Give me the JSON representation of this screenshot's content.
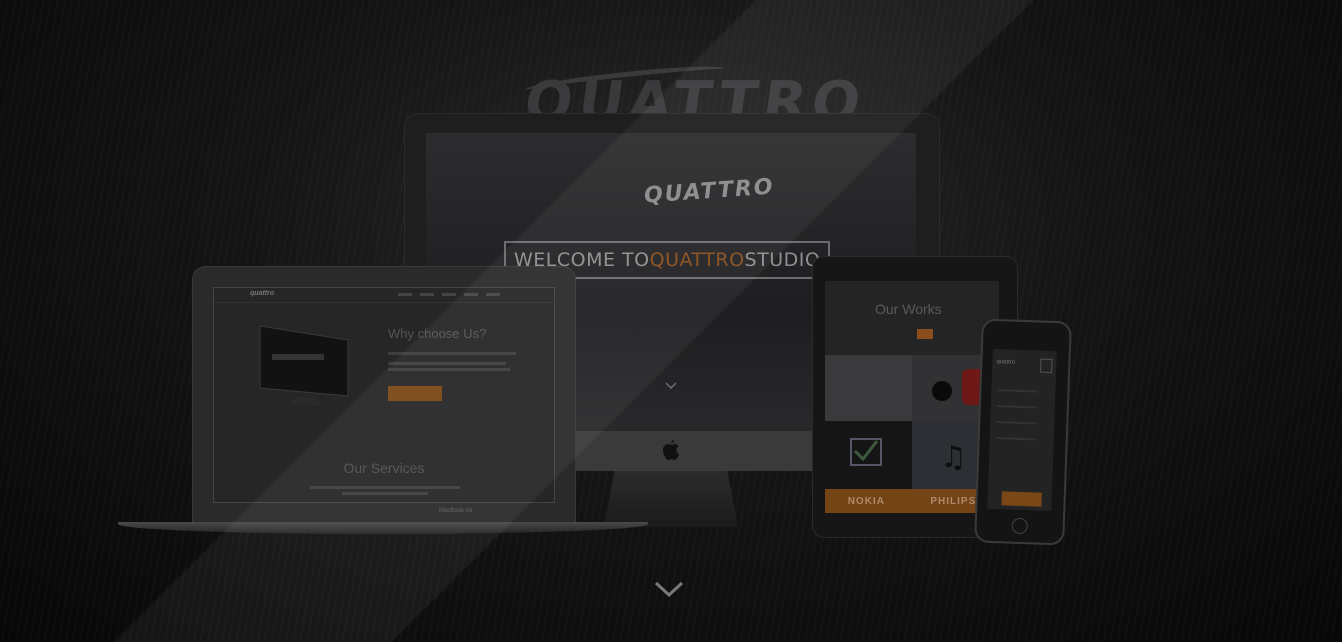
{
  "hero": {
    "background_logo": "QUATTRO",
    "accent_color": "#c96a1e"
  },
  "imac": {
    "screen_logo": "QUATTRO",
    "welcome_prefix": "WELCOME TO ",
    "welcome_accent": "QUATTRO",
    "welcome_suffix": " STUDIO"
  },
  "laptop": {
    "heading": "Why choose Us?",
    "section_title": "Our Services",
    "model_label": "MacBook Air",
    "screen_logo": "quattro"
  },
  "tablet": {
    "title": "Our Works",
    "brands": [
      "NOKIA",
      "PHILIPS"
    ]
  },
  "phone": {
    "logo": "quattro"
  },
  "icons": {
    "scroll_down": "chevron-down-icon",
    "apple": "apple-icon"
  }
}
